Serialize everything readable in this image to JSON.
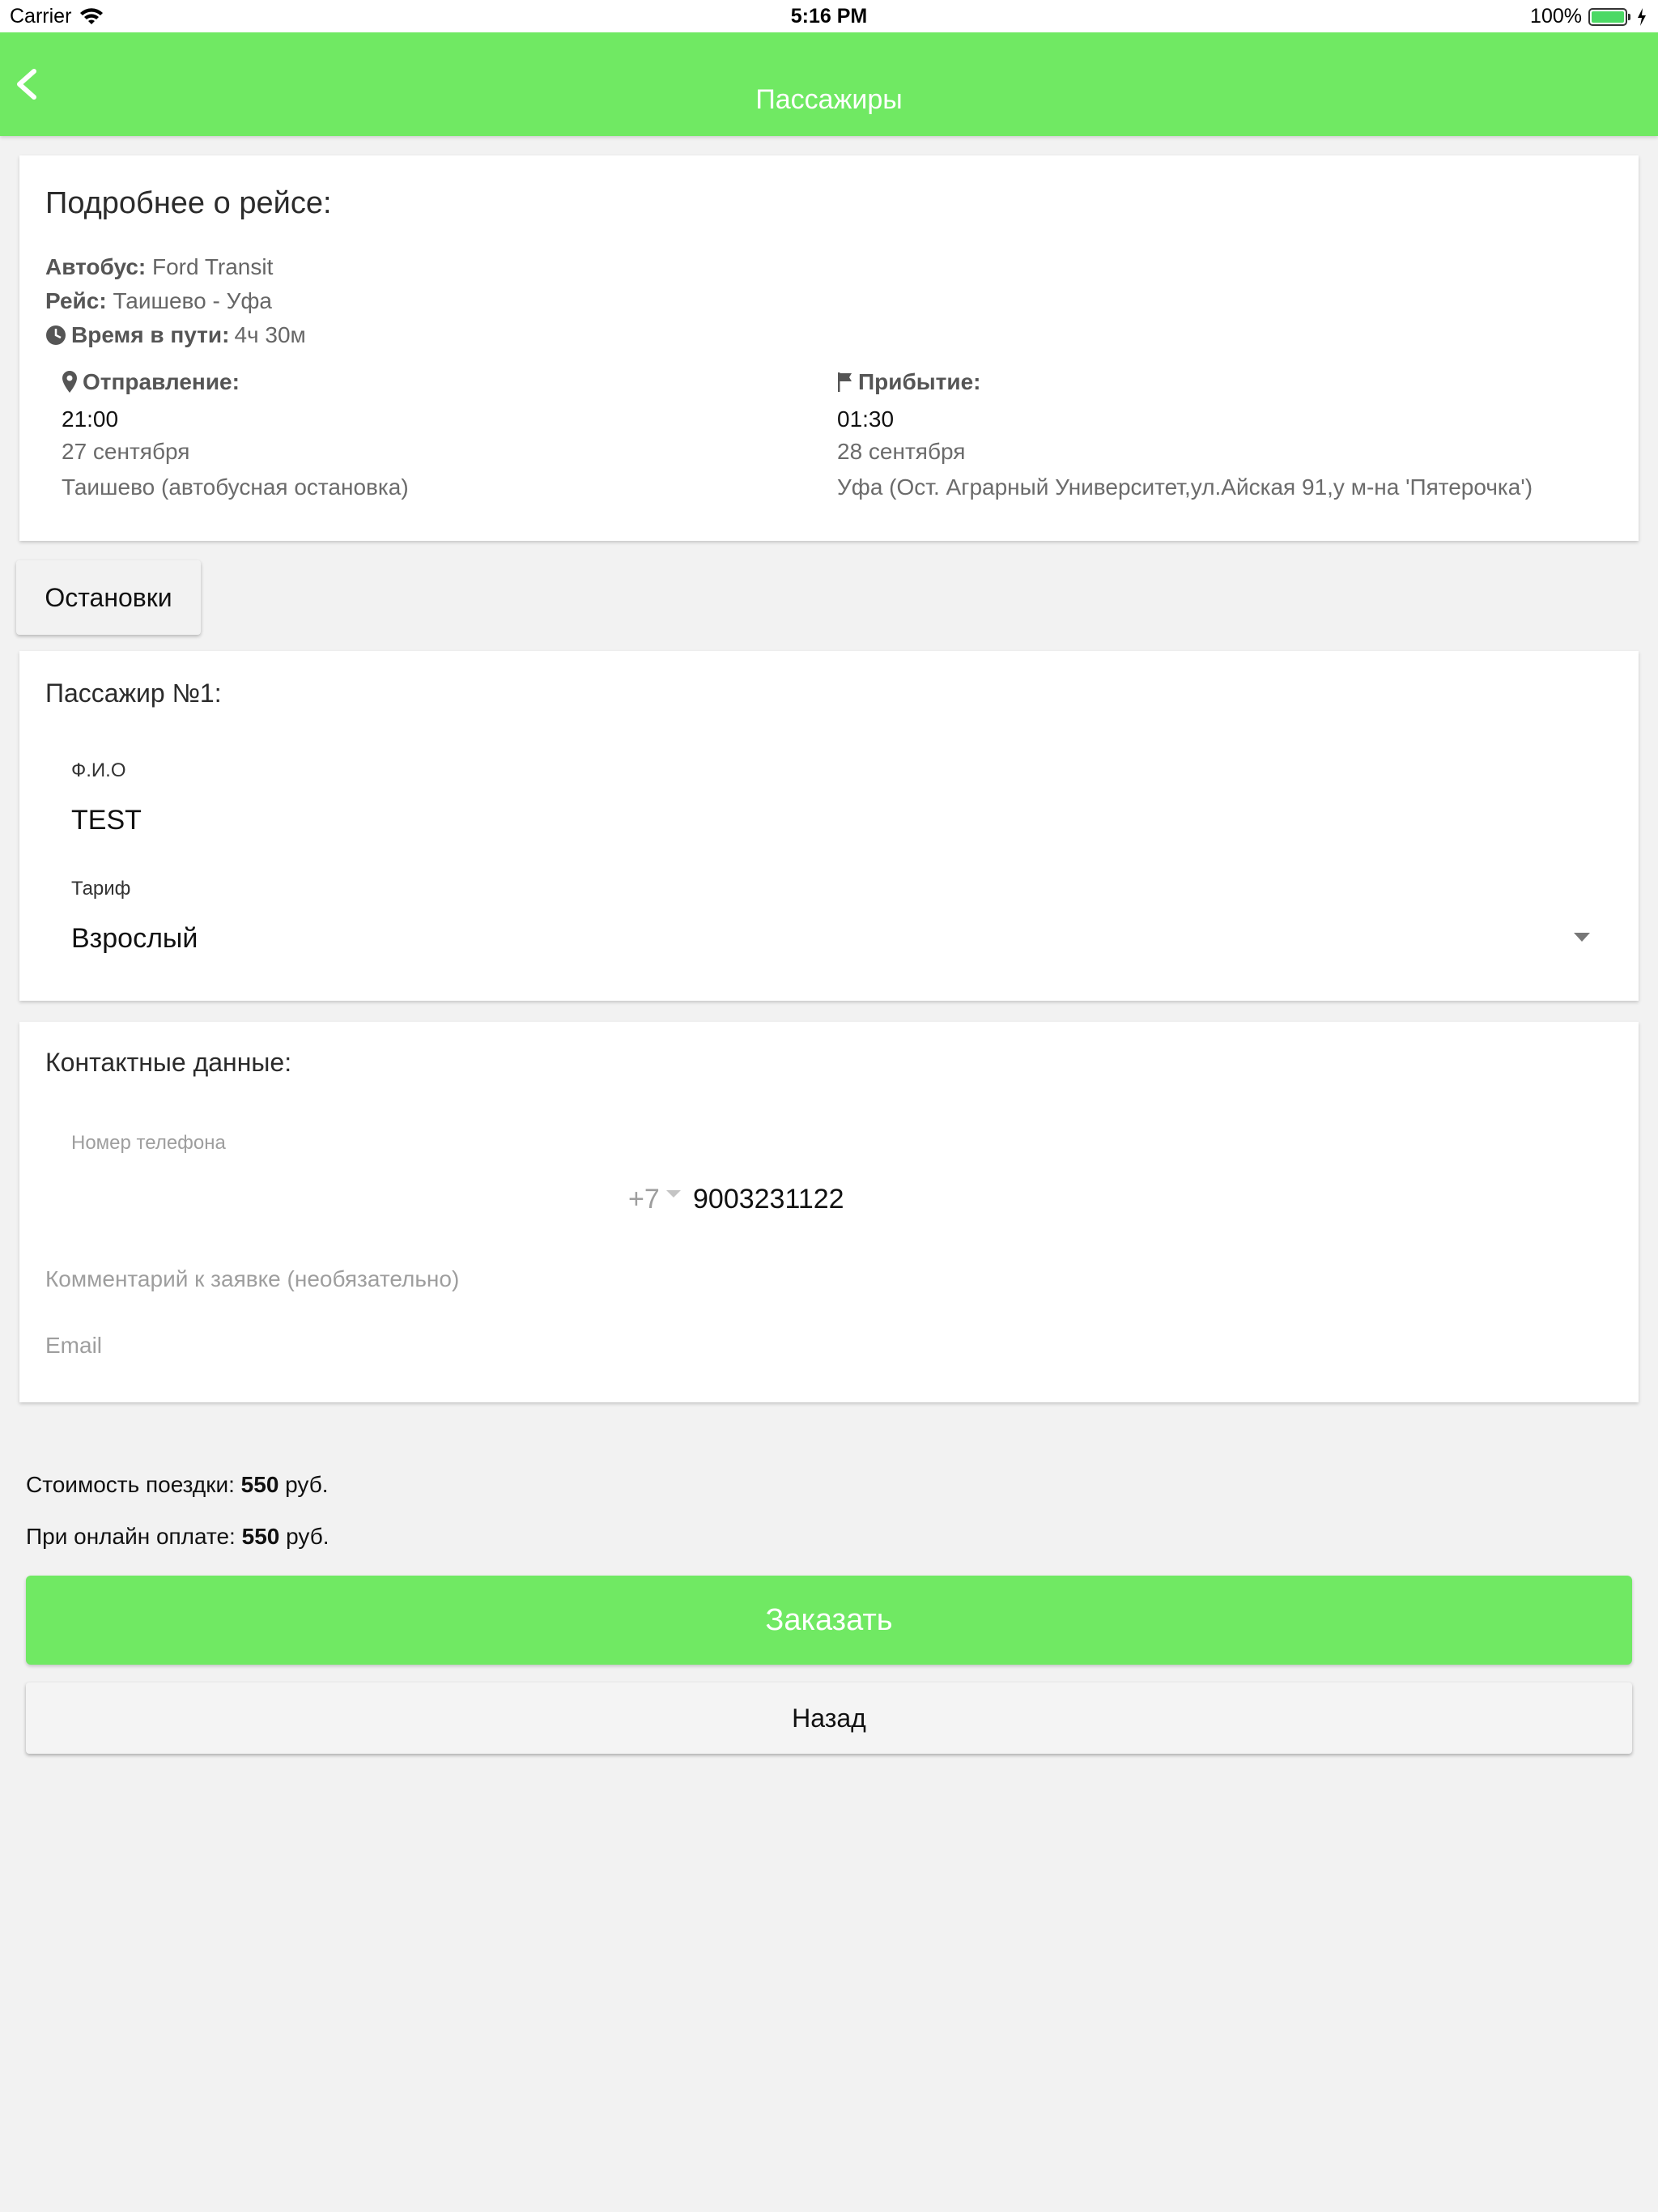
{
  "status_bar": {
    "carrier": "Carrier",
    "time": "5:16 PM",
    "battery": "100%"
  },
  "header": {
    "title": "Пассажиры",
    "back_icon": "chevron-left-icon"
  },
  "trip": {
    "title": "Подробнее о рейсе:",
    "bus_label": "Автобус:",
    "bus_value": "Ford Transit",
    "route_label": "Рейс:",
    "route_value": "Таишево - Уфа",
    "duration_label": "Время в пути:",
    "duration_value": "4ч 30м",
    "departure": {
      "label": "Отправление:",
      "time": "21:00",
      "date": "27 сентября",
      "place": "Таишево (автобусная остановка)"
    },
    "arrival": {
      "label": "Прибытие:",
      "time": "01:30",
      "date": "28 сентября",
      "place": "Уфа (Ост. Аграрный Университет,ул.Айская 91,у м-на 'Пятерочка')"
    }
  },
  "stops_button": "Остановки",
  "passenger": {
    "title": "Пассажир №1:",
    "name_label": "Ф.И.О",
    "name_value": "TEST",
    "tariff_label": "Тариф",
    "tariff_value": "Взрослый"
  },
  "contacts": {
    "title": "Контактные данные:",
    "phone_label": "Номер телефона",
    "phone_code": "+7",
    "phone_value": "9003231122",
    "comment_placeholder": "Комментарий к заявке (необязательно)",
    "email_placeholder": "Email"
  },
  "pricing": {
    "cost_label": "Стоимость поездки:",
    "cost_value": "550",
    "online_label": "При онлайн оплате:",
    "online_value": "550",
    "currency": "руб."
  },
  "actions": {
    "order": "Заказать",
    "back": "Назад"
  },
  "colors": {
    "accent": "#70e963",
    "background": "#f2f2f2"
  }
}
